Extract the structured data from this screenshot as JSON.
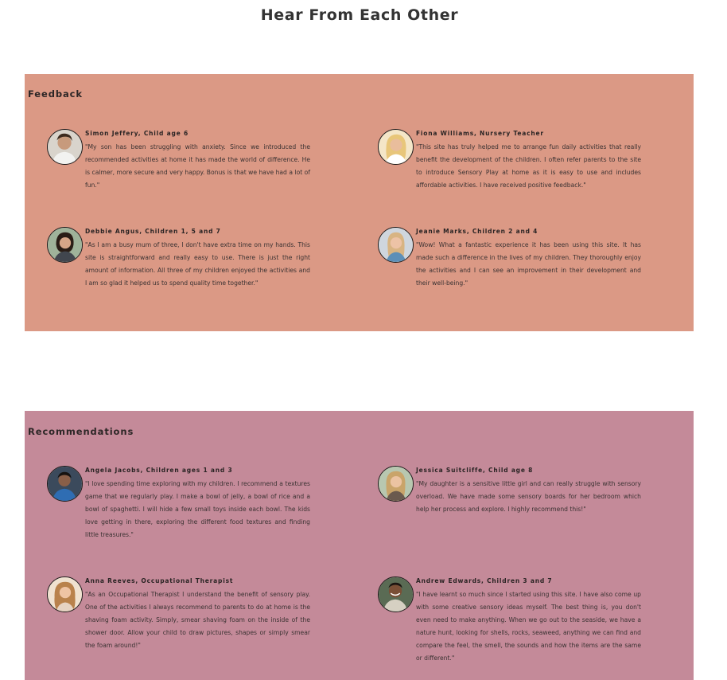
{
  "page": {
    "title": "Hear From Each Other"
  },
  "sections": [
    {
      "title": "Feedback",
      "background": "#db9985",
      "cards": [
        {
          "name": "Simon Jeffery, Child age 6",
          "text": "\"My son has been struggling with anxiety. Since we introduced the recommended activities at home it has made the world of difference. He is calmer, more secure and very happy. Bonus is that we have had a lot of fun.\"",
          "avatar": "man-curly-hair-photo"
        },
        {
          "name": "Fiona Williams, Nursery Teacher",
          "text": "\"This site has truly helped me to arrange fun daily activities that really benefit the development of the children. I often refer parents to the site to introduce Sensory Play at home as it is easy to use and includes affordable activities. I have received positive feedback.\"",
          "avatar": "woman-blonde-photo"
        },
        {
          "name": "Debbie Angus, Children 1, 5 and 7",
          "text": "\"As I am a busy mum of three, I don't have extra time on my hands. This site is straightforward and really easy to use. There is just the right amount of information. All three of my children enjoyed the activities and I am so glad it helped us to spend quality time together.\"",
          "avatar": "woman-dark-hair-photo"
        },
        {
          "name": "Jeanie Marks, Children 2 and 4",
          "text": "\"Wow! What a fantastic experience it has been using this site. It has made such a difference in the lives of my children. They thoroughly enjoy the activities and I can see an improvement in their development and their well-being.\"",
          "avatar": "woman-light-hair-photo"
        }
      ]
    },
    {
      "title": "Recommendations",
      "background": "#c48a99",
      "cards": [
        {
          "name": "Angela Jacobs, Children ages 1 and 3",
          "text": "\"I love spending time exploring with my children. I recommend a textures game that we regularly play. I make a bowl of jelly, a bowl of rice and a bowl of spaghetti. I will hide a few small toys inside each bowl. The kids love getting in there, exploring the different food textures and finding little treasures.\"",
          "avatar": "man-blue-shirt-photo"
        },
        {
          "name": "Jessica Suitcliffe, Child age 8",
          "text": "\"My daughter is a sensitive little girl and can really struggle with sensory overload. We have made some sensory boards for her bedroom which help her process and explore. I highly recommend this!\"",
          "avatar": "woman-blonde-smile-photo"
        },
        {
          "name": "Anna Reeves, Occupational Therapist",
          "text": "\"As an Occupational Therapist I understand the benefit of sensory play. One of the activities I always recommend to parents to do at home is the shaving foam activity. Simply, smear shaving foam on the inside of the shower door. Allow your child to draw pictures, shapes or simply smear the foam around!\"",
          "avatar": "woman-wavy-hair-photo"
        },
        {
          "name": "Andrew Edwards, Children 3 and 7",
          "text": "\"I have learnt so much since I started using this site. I have also come up with some creative sensory ideas myself. The best thing is, you don't even need to make anything. When we go out to the seaside, we have a nature hunt, looking for shells, rocks, seaweed, anything we can find and compare the feel, the smell, the sounds and how the items are the same or different.\"",
          "avatar": "man-smiling-photo"
        }
      ]
    }
  ]
}
